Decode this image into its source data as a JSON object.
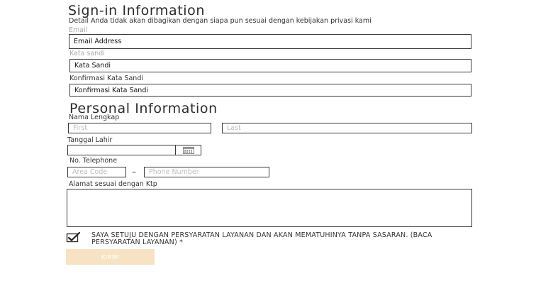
{
  "signin": {
    "title": "Sign-in Information",
    "description": "Detail Anda tidak akan dibagikan dengan siapa pun sesuai dengan kebijakan privasi kami",
    "email_label": "Email",
    "email_value": "Email Address",
    "password_label": "Kata sandi",
    "password_value": "Kata Sandi",
    "confirm_label": "Konfirmasi Kata Sandi",
    "confirm_value": "Konfirmasi Kata Sandi"
  },
  "personal": {
    "title": "Personal Information",
    "fullname_label": "Nama Lengkap",
    "first_placeholder": "First",
    "last_placeholder": "Last",
    "birthdate_label": "Tanggal Lahir",
    "birthdate_value": "",
    "phone_label": "No. Telephone",
    "area_placeholder": "Area Code",
    "phone_separator": "–",
    "phone_placeholder": "Phone Number",
    "address_label": "Alamat sesuai dengan Ktp",
    "address_value": ""
  },
  "agreement": {
    "checked": true,
    "text": "SAYA SETUJU DENGAN PERSYARATAN LAYANAN DAN AKAN MEMATUHINYA TANPA SASARAN. (BACA PERSYARATAN LAYANAN) *"
  },
  "submit": {
    "label": "KIRIM",
    "color": "#f7e3c3"
  },
  "icons": {
    "calendar": "calendar-icon",
    "check": "checkmark-icon"
  }
}
